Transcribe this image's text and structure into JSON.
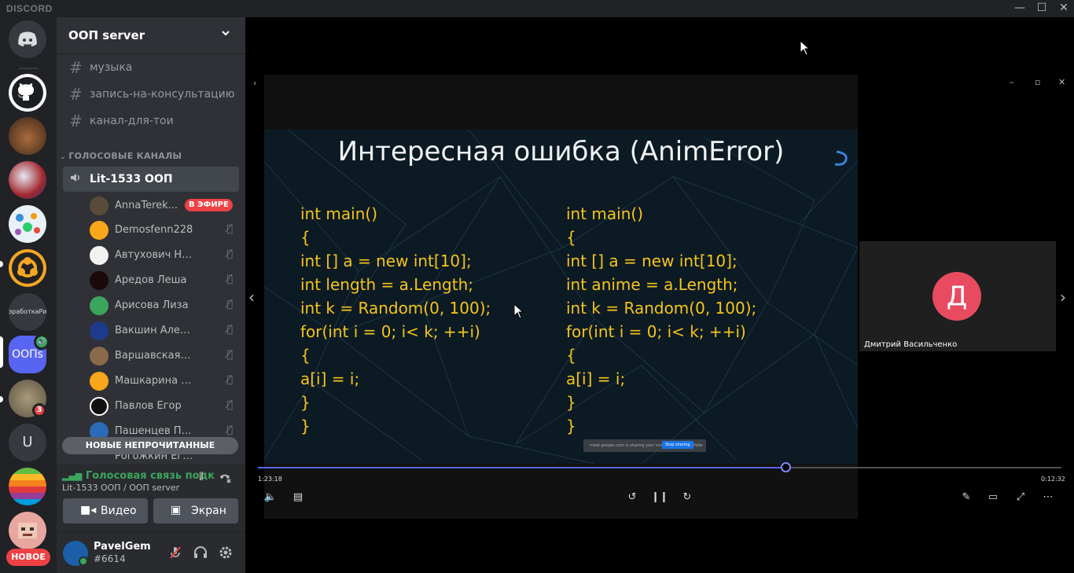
{
  "window": {
    "brand": "DISCORD",
    "minimize": "—",
    "maximize": "☐",
    "close": "✕"
  },
  "guilds": {
    "new_label": "НОВОЕ",
    "badge_count": "3",
    "ooп_label": "ООПs",
    "text_server": "зработкаРи",
    "letter_server": "U"
  },
  "server": {
    "name": "ООП server",
    "chevron": "⌄"
  },
  "channels": [
    {
      "name": "музыка"
    },
    {
      "name": "запись-на-консультацию"
    },
    {
      "name": "канал-для-тои"
    }
  ],
  "voice_category": "ГОЛОСОВЫЕ КАНАЛЫ",
  "voice_channel": "Lit-1533 ООП",
  "live_label": "В ЭФИРЕ",
  "members": [
    {
      "name": "AnnaTerek..."
    },
    {
      "name": "Demosfenn228"
    },
    {
      "name": "Автухович Наташа"
    },
    {
      "name": "Аредов Леша"
    },
    {
      "name": "Арисова Лиза"
    },
    {
      "name": "Вакшин Александр"
    },
    {
      "name": "Варшавская Ева"
    },
    {
      "name": "Машкарина Екате..."
    },
    {
      "name": "Павлов Егор"
    },
    {
      "name": "Пашенцев Павел"
    },
    {
      "name": "Рогожкин Егор"
    }
  ],
  "unread_label": "НОВЫЕ НЕПРОЧИТАННЫЕ",
  "voice_panel": {
    "status": "Голосовая связь подк",
    "location": "Lit-1533 ООП / ООП server",
    "video_label": "Видео",
    "screen_label": "Экран"
  },
  "user": {
    "name": "PavelGem",
    "tag": "#6614"
  },
  "slide": {
    "title": "Интересная ошибка (AnimError)",
    "left_code": "int main()\n{\nint [] a = new int[10];\nint length = a.Length;\nint k = Random(0, 100);\nfor(int i = 0; i< k; ++i)\n{\na[i] = i;\n}\n}",
    "right_code": "int main()\n{\nint [] a = new int[10];\nint anime = a.Length;\nint k = Random(0, 100);\nfor(int i = 0; i< k; ++i)\n{\na[i] = i;\n}\n}",
    "share_text": "meet.google.com is sharing your screen.",
    "stop_sharing": "Stop sharing",
    "hide": "Hide"
  },
  "participant": {
    "initial": "Д",
    "name": "Дмитрий Васильченко"
  },
  "player": {
    "elapsed": "1:23:18",
    "remaining": "0:12:32",
    "progress": 0.658
  },
  "colors": {
    "accent": "#5865f2",
    "live": "#ed4245",
    "online": "#3ba55d",
    "code": "#f5c518"
  }
}
